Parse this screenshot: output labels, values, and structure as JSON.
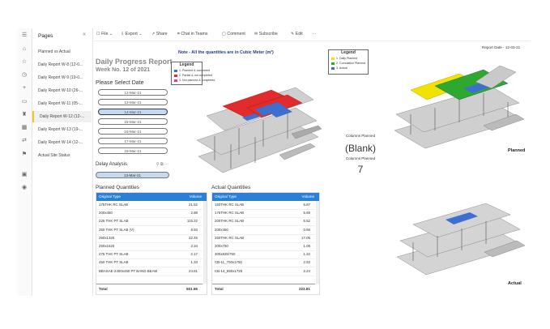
{
  "toolbar": {
    "file": "File",
    "export": "Export",
    "share": "Share",
    "chat": "Chat in Teams",
    "comment": "Comment",
    "subscribe": "Subscribe",
    "edit": "Edit",
    "more": "···"
  },
  "pages": {
    "header": "Pages",
    "items": [
      {
        "label": "Planned vs Actual",
        "active": false
      },
      {
        "label": "Daily Report W-8 (12-0...",
        "active": false
      },
      {
        "label": "Daily Report W-9 (19-0...",
        "active": false
      },
      {
        "label": "Daily Report W-10 (26-...",
        "active": false
      },
      {
        "label": "Daily Report W-11 (05-...",
        "active": false
      },
      {
        "label": "Daily Report W-12 (12-...",
        "active": true
      },
      {
        "label": "Daily Report W-13 (19-...",
        "active": false
      },
      {
        "label": "Daily Report W-14 (12-...",
        "active": false
      },
      {
        "label": "Actual Site Status",
        "active": false
      }
    ]
  },
  "report": {
    "title": "Daily Progress Report",
    "week": "Week No. 12 of 2021",
    "note": "Note - All the quantities are in Cubic Meter (m³)",
    "report_date": "Report Date - 12-03-21",
    "select_date_label": "Please Select Date",
    "dates": [
      "12-Mar-21",
      "13-Mar-21",
      "14-Mar-21",
      "15-Mar-21",
      "16-Mar-21",
      "17-Mar-21",
      "18-Mar-21"
    ],
    "selected_date": "14-Mar-21",
    "delay_label": "Delay Analysis",
    "delay_value": "13-Mar-21"
  },
  "planned": {
    "title": "Planned Quantities",
    "col1": "Original Type",
    "col2": "Volume",
    "rows": [
      [
        "175THK RC SLAB",
        "21.52"
      ],
      [
        "200x450",
        "2.88"
      ],
      [
        "225 THK PT SLAB",
        "115.22"
      ],
      [
        "250 THK PT SLAB (V)",
        "8.93"
      ],
      [
        "250x1325",
        "22.45"
      ],
      [
        "250x1625",
        "2.34"
      ],
      [
        "275 THK PT SLAB",
        "2.17"
      ],
      [
        "450 THK PT SLAB",
        "1.33"
      ],
      [
        "BBASAE-2400x450 PT BAND BEAM",
        "24.81"
      ]
    ],
    "total_label": "Total",
    "total": "501.66"
  },
  "actual": {
    "title": "Actual Quantities",
    "col1": "Original Type",
    "col2": "Volume",
    "rows": [
      [
        "150THK RC SLAB",
        "6.87"
      ],
      [
        "175THK RC SLAB",
        "5.69"
      ],
      [
        "200THK RC SLAB",
        "5.52"
      ],
      [
        "200x450",
        "0.68"
      ],
      [
        "250THK RC SLAB",
        "17.05"
      ],
      [
        "300x750",
        "1.08"
      ],
      [
        "300x825/750",
        "1.22"
      ],
      [
        "CB-11_700x1750",
        "2.53"
      ],
      [
        "CB-14_650x1725",
        "2.24"
      ]
    ],
    "total_label": "Total",
    "total": "223.81"
  },
  "kpis": {
    "columns_planned_label": "Columns Planned",
    "columns_planned_value": "(Blank)",
    "columns_planned_label2": "Columns Planned",
    "columns_planned_value2": "7"
  },
  "captions": {
    "planned": "Planned",
    "actual": "Actual"
  },
  "legend_left": {
    "title": "Legend",
    "items": [
      {
        "label": "1. Planned & completed",
        "color": "#3d6fd1"
      },
      {
        "label": "2. Partial & not completed",
        "color": "#e02c2c"
      },
      {
        "label": "3. Not planned & completed",
        "color": "#d43ab5"
      }
    ]
  },
  "legend_right": {
    "title": "Legend",
    "items": [
      {
        "label": "1. Daily Planned",
        "color": "#f2e200"
      },
      {
        "label": "2. Cumulative Planned",
        "color": "#2fa82f"
      },
      {
        "label": "3. Actual",
        "color": "#3d6fd1"
      }
    ]
  }
}
